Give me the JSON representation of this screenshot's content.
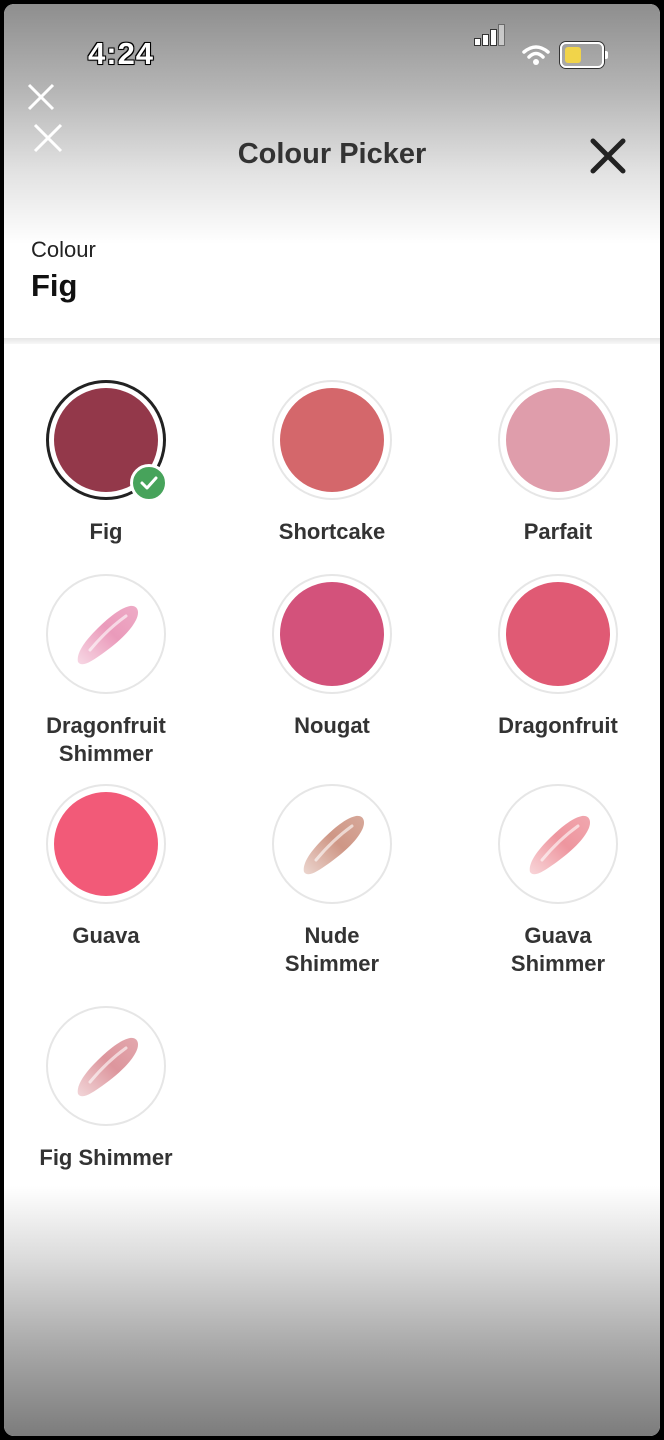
{
  "status_bar": {
    "time": "4:24"
  },
  "header": {
    "title": "Colour Picker"
  },
  "selection": {
    "label": "Colour",
    "value": "Fig"
  },
  "swatches": [
    {
      "name": "Fig",
      "type": "solid",
      "color": "#93384a",
      "selected": true
    },
    {
      "name": "Shortcake",
      "type": "solid",
      "color": "#d4676b",
      "selected": false
    },
    {
      "name": "Parfait",
      "type": "solid",
      "color": "#df9dab",
      "selected": false
    },
    {
      "name": "Dragonfruit Shimmer",
      "type": "shimmer",
      "color": "#e88fb3",
      "selected": false
    },
    {
      "name": "Nougat",
      "type": "solid",
      "color": "#d3527b",
      "selected": false
    },
    {
      "name": "Dragonfruit",
      "type": "solid",
      "color": "#e05a74",
      "selected": false
    },
    {
      "name": "Guava",
      "type": "solid",
      "color": "#f25a78",
      "selected": false
    },
    {
      "name": "Nude Shimmer",
      "type": "shimmer",
      "color": "#c98b78",
      "selected": false
    },
    {
      "name": "Guava Shimmer",
      "type": "shimmer",
      "color": "#ec8a94",
      "selected": false
    },
    {
      "name": "Fig Shimmer",
      "type": "shimmer",
      "color": "#d98a92",
      "selected": false
    }
  ],
  "colors": {
    "check": "#47a35b",
    "title": "#333333"
  }
}
